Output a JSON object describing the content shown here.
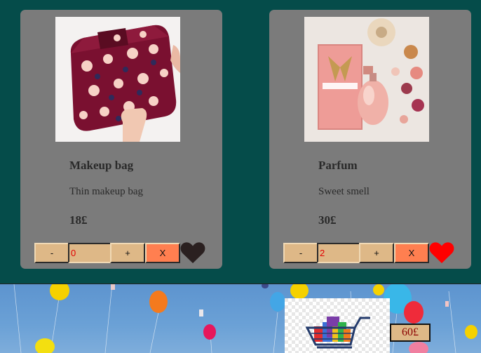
{
  "products": [
    {
      "name": "Makeup bag",
      "description": "Thin makeup bag",
      "price": "18£",
      "quantity": "0",
      "minus_label": "-",
      "plus_label": "+",
      "remove_label": "X",
      "favorite": false,
      "heart_color": "#2a2020"
    },
    {
      "name": "Parfum",
      "description": "Sweet smell",
      "price": "30£",
      "quantity": "2",
      "minus_label": "-",
      "plus_label": "+",
      "remove_label": "X",
      "favorite": true,
      "heart_color": "#ff0000"
    }
  ],
  "cart": {
    "total": "60£",
    "icon": "shopping-cart-icon"
  },
  "colors": {
    "page_background": "#054c4a",
    "card_background": "#7b7b7b",
    "button_background": "#deb887",
    "remove_button_background": "#ff7f50",
    "quantity_text": "#e00000"
  }
}
